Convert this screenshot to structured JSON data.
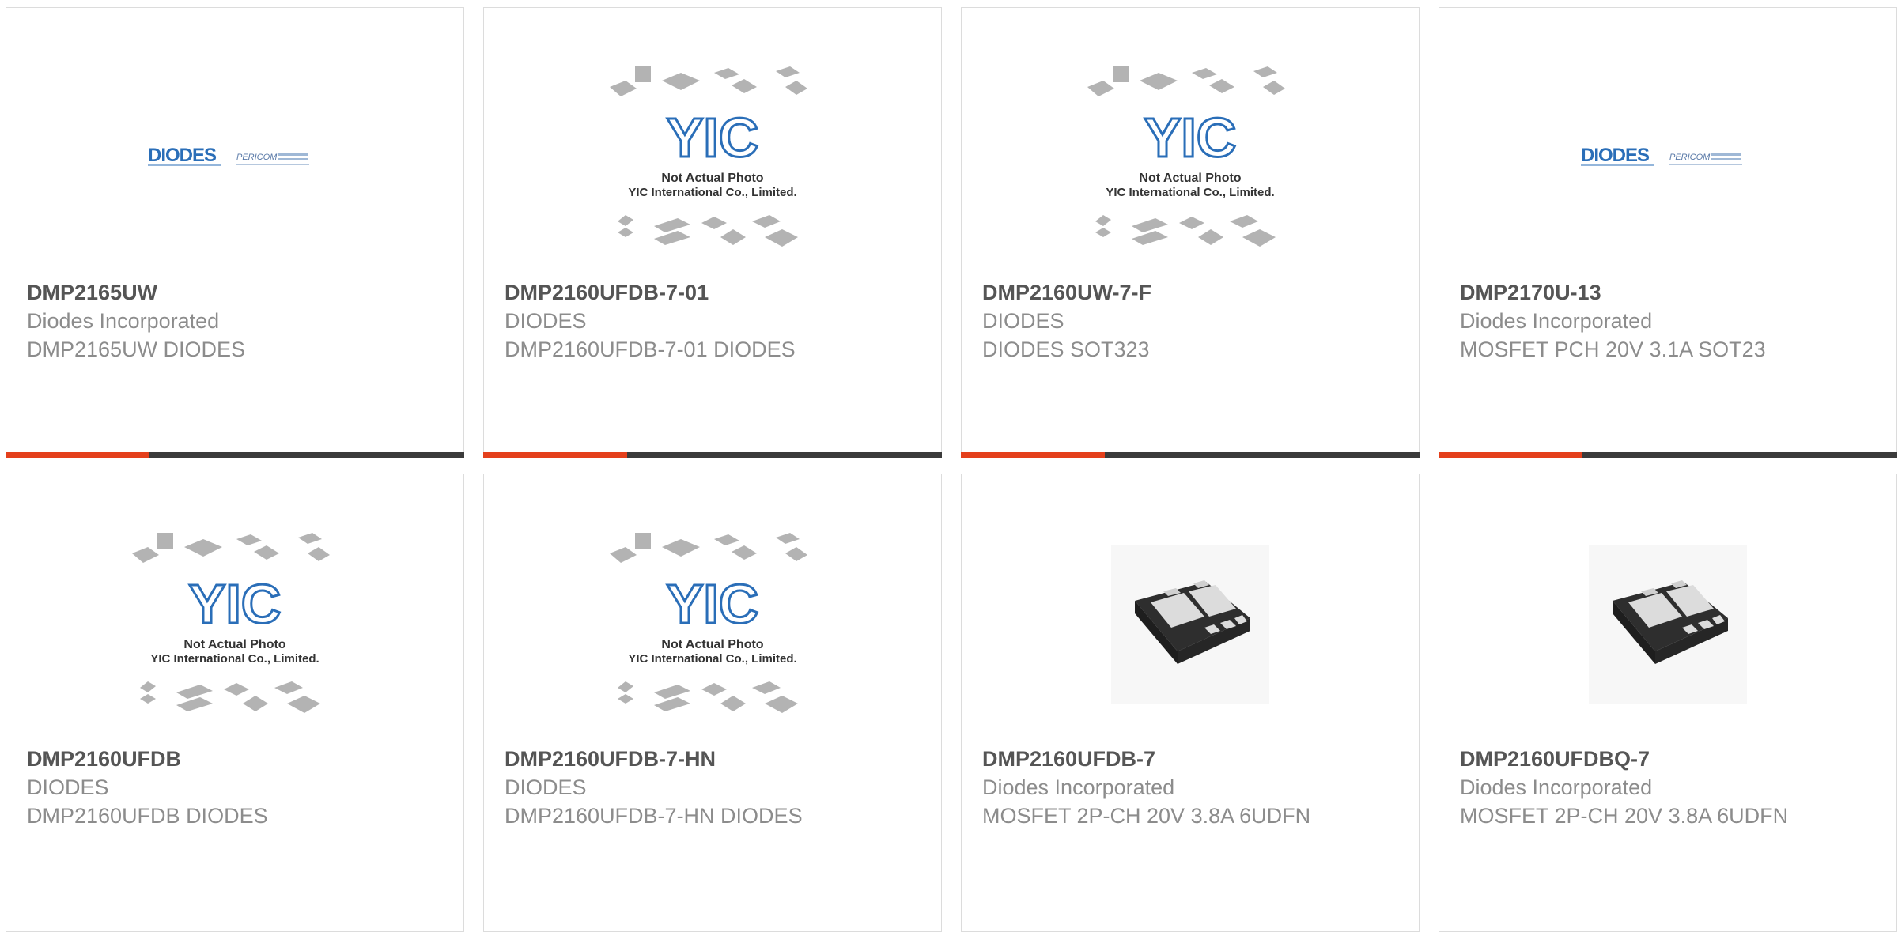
{
  "products": [
    {
      "part": "DMP2165UW",
      "manufacturer": "Diodes Incorporated",
      "description": "DMP2165UW DIODES",
      "image": "diodes-pericom-logo"
    },
    {
      "part": "DMP2160UFDB-7-01",
      "manufacturer": "DIODES",
      "description": "DMP2160UFDB-7-01 DIODES",
      "image": "not-actual-photo"
    },
    {
      "part": "DMP2160UW-7-F",
      "manufacturer": "DIODES",
      "description": "DIODES SOT323",
      "image": "not-actual-photo"
    },
    {
      "part": "DMP2170U-13",
      "manufacturer": "Diodes Incorporated",
      "description": "MOSFET PCH 20V 3.1A SOT23",
      "image": "diodes-pericom-logo"
    },
    {
      "part": "DMP2160UFDB",
      "manufacturer": "DIODES",
      "description": "DMP2160UFDB DIODES",
      "image": "not-actual-photo"
    },
    {
      "part": "DMP2160UFDB-7-HN",
      "manufacturer": "DIODES",
      "description": "DMP2160UFDB-7-HN DIODES",
      "image": "not-actual-photo"
    },
    {
      "part": "DMP2160UFDB-7",
      "manufacturer": "Diodes Incorporated",
      "description": "MOSFET 2P-CH 20V 3.8A 6UDFN",
      "image": "udfn-package-photo"
    },
    {
      "part": "DMP2160UFDBQ-7",
      "manufacturer": "Diodes Incorporated",
      "description": "MOSFET 2P-CH 20V 3.8A 6UDFN",
      "image": "udfn-package-photo"
    }
  ],
  "placeholder": {
    "line1": "Not Actual Photo",
    "line2": "YIC International Co., Limited.",
    "logo": "YIC"
  },
  "logo": {
    "brand": "DIODES",
    "sub": "PERICOM"
  },
  "colors": {
    "accent": "#e4401c",
    "bar": "#3b3b3b",
    "border": "#dcdcdc",
    "title": "#555555",
    "text": "#8c8c8c",
    "logo_blue": "#2a6eb8"
  }
}
